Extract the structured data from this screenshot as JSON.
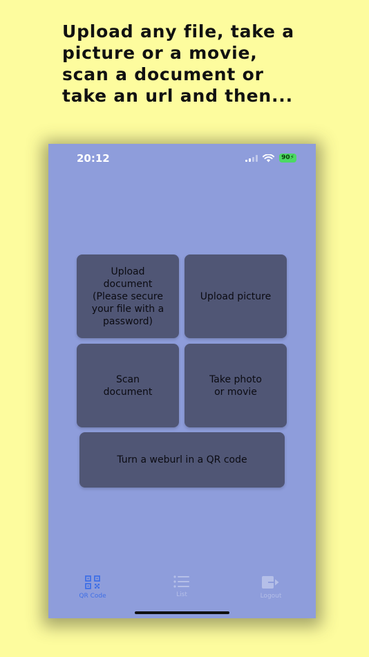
{
  "headline": "Upload any file, take a\npicture or a movie,\nscan a document or\ntake an url and then...",
  "status_bar": {
    "time": "20:12",
    "battery": "90",
    "icons": [
      "cellular-signal-icon",
      "wifi-icon",
      "battery-icon"
    ]
  },
  "tiles": {
    "upload_document": "Upload\ndocument\n(Please secure\nyour file with a\npassword)",
    "upload_picture": "Upload picture",
    "scan_document": "Scan\ndocument",
    "take_photo": "Take photo\nor movie",
    "weburl_qr": "Turn a weburl in a QR code"
  },
  "tab_bar": {
    "tabs": [
      {
        "label": "QR Code",
        "icon": "qr-code-icon",
        "active": true
      },
      {
        "label": "List",
        "icon": "list-icon",
        "active": false
      },
      {
        "label": "Logout",
        "icon": "logout-icon",
        "active": false
      }
    ]
  },
  "colors": {
    "page_background": "#fdfc9e",
    "app_background": "#8e9ddb",
    "tile": "#505675",
    "tab_active": "#3f6fe6",
    "tab_inactive": "#b5bfe8"
  }
}
